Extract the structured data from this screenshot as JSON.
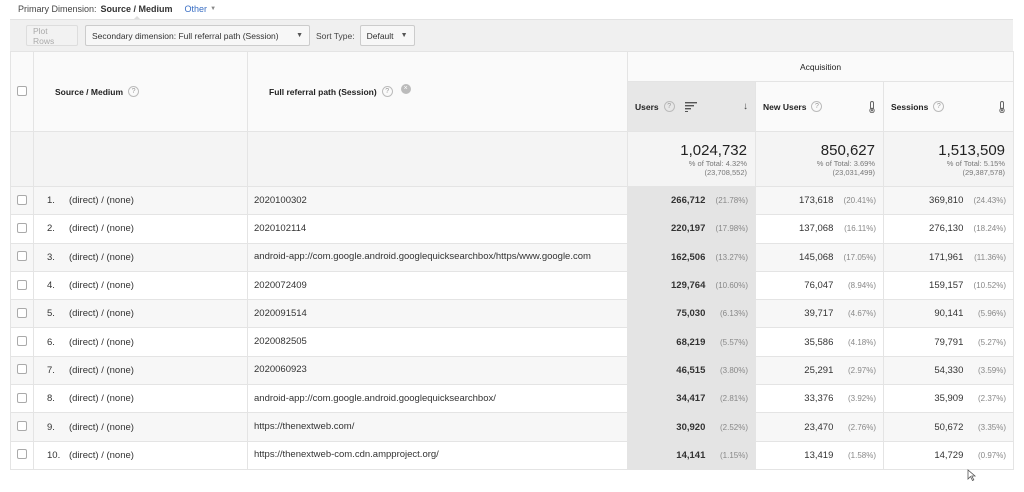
{
  "primary": {
    "label": "Primary Dimension:",
    "selected": "Source / Medium",
    "other": "Other",
    "other_caret": "▼"
  },
  "toolbar": {
    "plot_rows": "Plot Rows",
    "secondary": "Secondary dimension: Full referral path (Session)",
    "sort_label": "Sort Type:",
    "sort_value": "Default",
    "caret": "▼"
  },
  "header": {
    "source_medium": "Source / Medium",
    "full_referral_path": "Full referral path (Session)",
    "acquisition": "Acquisition",
    "users": "Users",
    "new_users": "New Users",
    "sessions": "Sessions",
    "help": "?",
    "remove": "×",
    "sort_arrow": "↓",
    "thermo": "🌡"
  },
  "totals": {
    "users": {
      "value": "1,024,732",
      "pct": "% of Total: 4.32%",
      "total": "(23,708,552)"
    },
    "new_users": {
      "value": "850,627",
      "pct": "% of Total: 3.69%",
      "total": "(23,031,499)"
    },
    "sessions": {
      "value": "1,513,509",
      "pct": "% of Total: 5.15%",
      "total": "(29,387,578)"
    }
  },
  "rows": [
    {
      "idx": "1.",
      "source": "(direct) / (none)",
      "path": "2020100302",
      "users": "266,712",
      "users_pct": "(21.78%)",
      "new_users": "173,618",
      "new_users_pct": "(20.41%)",
      "sessions": "369,810",
      "sessions_pct": "(24.43%)"
    },
    {
      "idx": "2.",
      "source": "(direct) / (none)",
      "path": "2020102114",
      "users": "220,197",
      "users_pct": "(17.98%)",
      "new_users": "137,068",
      "new_users_pct": "(16.11%)",
      "sessions": "276,130",
      "sessions_pct": "(18.24%)"
    },
    {
      "idx": "3.",
      "source": "(direct) / (none)",
      "path": "android-app://com.google.android.googlequicksearchbox/https/www.google.com",
      "users": "162,506",
      "users_pct": "(13.27%)",
      "new_users": "145,068",
      "new_users_pct": "(17.05%)",
      "sessions": "171,961",
      "sessions_pct": "(11.36%)"
    },
    {
      "idx": "4.",
      "source": "(direct) / (none)",
      "path": "2020072409",
      "users": "129,764",
      "users_pct": "(10.60%)",
      "new_users": "76,047",
      "new_users_pct": "(8.94%)",
      "sessions": "159,157",
      "sessions_pct": "(10.52%)"
    },
    {
      "idx": "5.",
      "source": "(direct) / (none)",
      "path": "2020091514",
      "users": "75,030",
      "users_pct": "(6.13%)",
      "new_users": "39,717",
      "new_users_pct": "(4.67%)",
      "sessions": "90,141",
      "sessions_pct": "(5.96%)"
    },
    {
      "idx": "6.",
      "source": "(direct) / (none)",
      "path": "2020082505",
      "users": "68,219",
      "users_pct": "(5.57%)",
      "new_users": "35,586",
      "new_users_pct": "(4.18%)",
      "sessions": "79,791",
      "sessions_pct": "(5.27%)"
    },
    {
      "idx": "7.",
      "source": "(direct) / (none)",
      "path": "2020060923",
      "users": "46,515",
      "users_pct": "(3.80%)",
      "new_users": "25,291",
      "new_users_pct": "(2.97%)",
      "sessions": "54,330",
      "sessions_pct": "(3.59%)"
    },
    {
      "idx": "8.",
      "source": "(direct) / (none)",
      "path": "android-app://com.google.android.googlequicksearchbox/",
      "users": "34,417",
      "users_pct": "(2.81%)",
      "new_users": "33,376",
      "new_users_pct": "(3.92%)",
      "sessions": "35,909",
      "sessions_pct": "(2.37%)"
    },
    {
      "idx": "9.",
      "source": "(direct) / (none)",
      "path": "https://thenextweb.com/",
      "users": "30,920",
      "users_pct": "(2.52%)",
      "new_users": "23,470",
      "new_users_pct": "(2.76%)",
      "sessions": "50,672",
      "sessions_pct": "(3.35%)"
    },
    {
      "idx": "10.",
      "source": "(direct) / (none)",
      "path": "https://thenextweb-com.cdn.ampproject.org/",
      "users": "14,141",
      "users_pct": "(1.15%)",
      "new_users": "13,419",
      "new_users_pct": "(1.58%)",
      "sessions": "14,729",
      "sessions_pct": "(0.97%)"
    }
  ]
}
